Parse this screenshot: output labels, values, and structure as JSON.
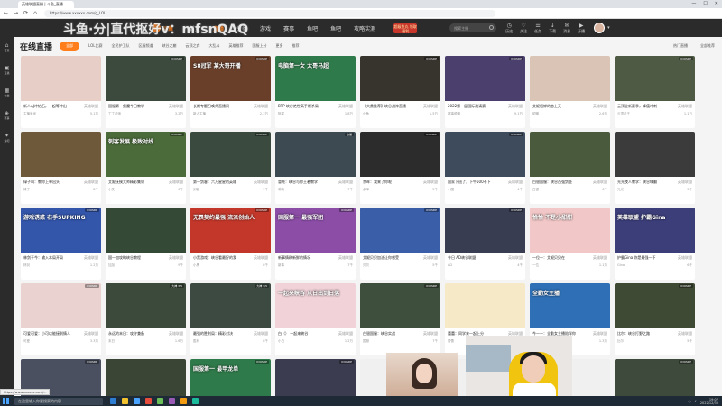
{
  "browser": {
    "tab_title": "英雄联盟直播 | 斗鱼_直播...",
    "url": "https://www.xxxxxx.com/g_LOL",
    "win_controls": [
      "—",
      "☐",
      "✕"
    ],
    "nav_icons": [
      "←",
      "→",
      "⟳",
      "⌂"
    ],
    "status_url": "https://www.xxxxxx.com/..."
  },
  "watermark": "斗鱼·分|直代抠好v：mfsnQAQ",
  "header": {
    "logo_text": "斗鱼",
    "nav": [
      "首页",
      "直播",
      "分类",
      "游戏",
      "赛事",
      "鱼吧",
      "鱼吧",
      "攻略实测"
    ],
    "active_nav_index": 1,
    "promo_text": "超级鱼丸 领取福利",
    "search_placeholder": "搜索主播",
    "icons": [
      {
        "icon": "history-icon",
        "glyph": "◷",
        "label": "历史"
      },
      {
        "icon": "follow-icon",
        "glyph": "♡",
        "label": "关注"
      },
      {
        "icon": "task-icon",
        "glyph": "☰",
        "label": "任务"
      },
      {
        "icon": "download-icon",
        "glyph": "↓",
        "label": "下载"
      },
      {
        "icon": "message-icon",
        "glyph": "✉",
        "label": "消息"
      },
      {
        "icon": "broadcast-icon",
        "glyph": "▶",
        "label": "开播"
      }
    ],
    "user_menu": "▾"
  },
  "sidebar": [
    {
      "icon": "home-icon",
      "glyph": "⌂",
      "label": "首页"
    },
    {
      "icon": "live-icon",
      "glyph": "▣",
      "label": "直播"
    },
    {
      "icon": "category-icon",
      "glyph": "▦",
      "label": "分类"
    },
    {
      "icon": "event-icon",
      "glyph": "◈",
      "label": "赛事"
    },
    {
      "icon": "fishbar-icon",
      "glyph": "✦",
      "label": "鱼吧"
    }
  ],
  "main": {
    "title": "在线直播",
    "filters": [
      "全部",
      "LOL比赛",
      "全民护卫队",
      "区服频道",
      "峡谷之巅",
      "云顶之弈",
      "大乱斗",
      "英雄推荐",
      "国服上分",
      "更多",
      "推荐"
    ],
    "active_filter_index": 0,
    "filter_right": [
      "热门直播",
      "全部推荐"
    ]
  },
  "cards": [
    {
      "title": "新人AJ冲钻石，一起等冲出",
      "category": "英雄联盟",
      "streamer": "主播米米",
      "heat": "5.1万",
      "bg": "#e7cfc8",
      "overlay": "",
      "tag": ""
    },
    {
      "title": "国服第一剑魔今日教学",
      "category": "英雄联盟",
      "streamer": "丁丁老师",
      "heat": "3.2万",
      "bg": "#3c4a3e",
      "overlay": "",
      "tag": "IDOSDP"
    },
    {
      "title": "长期专题召唤师直播间",
      "category": "英雄联盟",
      "streamer": "新人主播",
      "heat": "2.3万",
      "bg": "#6a3f2a",
      "overlay": "S8冠军 某大哥开播",
      "tag": "IDOSDP"
    },
    {
      "title": "BTP 峡谷绝世高手爆杀局",
      "category": "英雄联盟",
      "streamer": "阿星",
      "heat": "1.8万",
      "bg": "#2f7a4a",
      "overlay": "电脑第一女 太哥马超",
      "tag": ""
    },
    {
      "title": "【大鼎推荐】峡谷战神直播",
      "category": "英雄联盟",
      "streamer": "小鱼",
      "heat": "1.5万",
      "bg": "#37342e",
      "overlay": "",
      "tag": "IDOSDP"
    },
    {
      "title": "2022第一届国际邀请赛",
      "category": "英雄联盟",
      "streamer": "赛事频道",
      "heat": "9.1万",
      "bg": "#4b3f6e",
      "overlay": "",
      "tag": "IDOSDP"
    },
    {
      "title": "艾妮貂蝉的恋上天",
      "category": "英雄联盟",
      "streamer": "貂蝉",
      "heat": "2.6万",
      "bg": "#d9c4b5",
      "overlay": "",
      "tag": ""
    },
    {
      "title": "云顶全新赛季，峰值冲刺",
      "category": "英雄联盟",
      "streamer": "云顶老王",
      "heat": "1.1万",
      "bg": "#4f5a45",
      "overlay": "",
      "tag": "IDOSDP"
    },
    {
      "title": "绿子叫：教你上单出头",
      "category": "英雄联盟",
      "streamer": "绿子",
      "heat": "8千",
      "bg": "#6e5a3b",
      "overlay": "",
      "tag": ""
    },
    {
      "title": "艾妮抚摸大师精彩集锦",
      "category": "英雄联盟",
      "streamer": "小艾",
      "heat": "6千",
      "bg": "#4b6b3a",
      "overlay": "刺客发展 极致对线",
      "tag": "IDOSDP"
    },
    {
      "title": "第一剑客：六万星星的英雄",
      "category": "英雄联盟",
      "streamer": "剑客",
      "heat": "9千",
      "bg": "#3a4a3f",
      "overlay": "",
      "tag": "IDOSDP"
    },
    {
      "title": "冒充：峡谷与你王者教学",
      "category": "英雄联盟",
      "streamer": "萌萌",
      "heat": "7千",
      "bg": "#3d4a52",
      "overlay": "",
      "tag": "热播"
    },
    {
      "title": "余晖：我来了你呢",
      "category": "英雄联盟",
      "streamer": "余晖",
      "heat": "5千",
      "bg": "#2c2c2c",
      "overlay": "",
      "tag": "IDOSDP"
    },
    {
      "title": "国家下班了，下午500不下",
      "category": "英雄联盟",
      "streamer": "小国",
      "heat": "4千",
      "bg": "#3e4b5d",
      "overlay": "",
      "tag": "IDOSDP"
    },
    {
      "title": "白银国服：峡谷百强剑圣",
      "category": "英雄联盟",
      "streamer": "白银",
      "heat": "6千",
      "bg": "#4a5a3c",
      "overlay": "",
      "tag": ""
    },
    {
      "title": "光光夜人教学：峡谷嗨翻",
      "category": "英雄联盟",
      "streamer": "光光",
      "heat": "3千",
      "bg": "#3b3b3b",
      "overlay": "",
      "tag": ""
    },
    {
      "title": "林剑于今：输入本局开局",
      "category": "英雄联盟",
      "streamer": "林剑",
      "heat": "1.2万",
      "bg": "#3355aa",
      "overlay": "游戏诱惑 右手SUPKING",
      "tag": "IDOSDP"
    },
    {
      "title": "国一加攻略峡谷教程",
      "category": "英雄联盟",
      "streamer": "加加",
      "heat": "9千",
      "bg": "#344a36",
      "overlay": "",
      "tag": ""
    },
    {
      "title": "小黑游戏：峡谷看最好的我",
      "category": "英雄联盟",
      "streamer": "小黑",
      "heat": "8千",
      "bg": "#c2372a",
      "overlay": "无畏契约最强 流派创始人",
      "tag": "IDOSDP"
    },
    {
      "title": "新事情刷新鲜的情况",
      "category": "英雄联盟",
      "streamer": "新事",
      "heat": "7千",
      "bg": "#8b4da6",
      "overlay": "国服第一 最强军团",
      "tag": "IDOSDP"
    },
    {
      "title": "艾妮贝贝加油让你感受",
      "category": "英雄联盟",
      "streamer": "贝贝",
      "heat": "5千",
      "bg": "#3a5fa8",
      "overlay": "",
      "tag": "IDOSDP"
    },
    {
      "title": "今日 AD峡谷联盟",
      "category": "英雄联盟",
      "streamer": "AD",
      "heat": "4千",
      "bg": "#383d52",
      "overlay": "",
      "tag": "IDOSDP"
    },
    {
      "title": "一位一：艾妮贝贝在",
      "category": "英雄联盟",
      "streamer": "一位",
      "heat": "1.1万",
      "bg": "#f2c7c7",
      "overlay": "恰恰 不是小甜甜",
      "tag": ""
    },
    {
      "title": "护霸Gina 你是最强一下",
      "category": "英雄联盟",
      "streamer": "Gina",
      "heat": "6千",
      "bg": "#3c3e7a",
      "overlay": "英雄联盟 护霸Gina",
      "tag": ""
    },
    {
      "title": "可爱可爱：小可以能接到情人",
      "category": "英雄联盟",
      "streamer": "可爱",
      "heat": "3.3万",
      "bg": "#e9d2cf",
      "overlay": "",
      "tag": "IDOSDP"
    },
    {
      "title": "永远的末日：攻守兼备",
      "category": "英雄联盟",
      "streamer": "末日",
      "heat": "1.6万",
      "bg": "#3b4a3a",
      "overlay": "",
      "tag": "大神 3/5"
    },
    {
      "title": "最强的胜利局：精彩对决",
      "category": "英雄联盟",
      "streamer": "胜利",
      "heat": "8千",
      "bg": "#3d4a42",
      "overlay": "",
      "tag": "大神 3/5"
    },
    {
      "title": "白（） 一起来峡谷",
      "category": "英雄联盟",
      "streamer": "小白",
      "heat": "1.2万",
      "bg": "#f0d2d8",
      "overlay": "一起来峡谷 从日出到日落",
      "tag": ""
    },
    {
      "title": "白银国服：峡谷实战",
      "category": "英雄联盟",
      "streamer": "国服",
      "heat": "7千",
      "bg": "#3f4f3d",
      "overlay": "",
      "tag": "IDOSDP"
    },
    {
      "title": "蕾蕾：同学来一起上分",
      "category": "英雄联盟",
      "streamer": "蕾蕾",
      "heat": "9千",
      "bg": "#f6e9c8",
      "overlay": "",
      "tag": ""
    },
    {
      "title": "今一一：全勤女主播陪伴你",
      "category": "英雄联盟",
      "streamer": "今一",
      "heat": "1.3万",
      "bg": "#2e6fb5",
      "overlay": "全勤女主播",
      "tag": ""
    },
    {
      "title": "比尔：峡谷打野之路",
      "category": "英雄联盟",
      "streamer": "比尔",
      "heat": "5千",
      "bg": "#3f4a35",
      "overlay": "",
      "tag": "IDOSDP"
    }
  ],
  "partial_row": [
    {
      "bg": "#4a5060",
      "overlay": "",
      "tag": "IDOSDP"
    },
    {
      "bg": "#3b4535",
      "overlay": "",
      "tag": ""
    },
    {
      "bg": "#2f7a4a",
      "overlay": "国服第一 最甲龙单",
      "tag": "IDOSDP"
    },
    {
      "bg": "#3c3c50",
      "overlay": "",
      "tag": "IDOSDP"
    },
    {
      "bg": "#f0f0f0",
      "overlay": "",
      "tag": ""
    },
    {
      "bg": "#f0f0f0",
      "overlay": "",
      "tag": ""
    },
    {
      "bg": "#f0f0f0",
      "overlay": "",
      "tag": ""
    },
    {
      "bg": "#3e4a3c",
      "overlay": "",
      "tag": "IDOSDP"
    }
  ],
  "taskbar": {
    "search_text": "在这里输入你要搜索的内容",
    "time": "19:07",
    "date": "2022/12/30",
    "app_colors": [
      "#2d7dd2",
      "#f2c12e",
      "#4aa3ff",
      "#e84c3d",
      "#6bbf59",
      "#9b59b6",
      "#f39c12",
      "#1abc9c"
    ]
  }
}
